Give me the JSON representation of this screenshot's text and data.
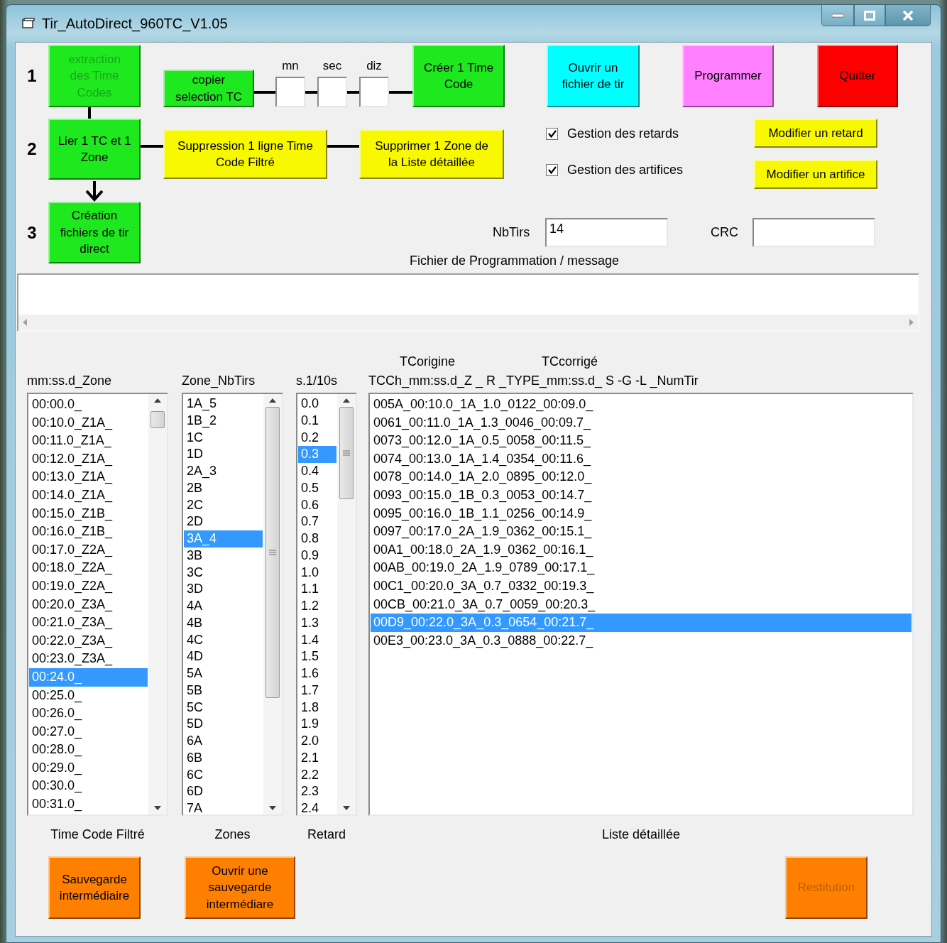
{
  "window": {
    "title": "Tir_AutoDirect_960TC_V1.05"
  },
  "step_1": {
    "number": "1",
    "extract_button": {
      "label": "extraction\ndes Time\nCodes",
      "color": "#1ee81e",
      "disabled": true
    },
    "copy_button": {
      "label": "copier\nselection TC",
      "color": "#1ee81e",
      "disabled": false
    },
    "time_fields": [
      {
        "label": "mn"
      },
      {
        "label": "sec"
      },
      {
        "label": "diz"
      }
    ],
    "create_button": {
      "label": "Créer 1 Time\nCode",
      "color": "#1ee81e",
      "disabled": false
    }
  },
  "actions": [
    {
      "label": "Ouvrir un\nfichier de tir",
      "color": "#00ffff",
      "disabled": false
    },
    {
      "label": "Programmer",
      "color": "#ff80ff",
      "disabled": false
    },
    {
      "label": "Quitter",
      "color": "#ff0000",
      "disabled": false
    }
  ],
  "step_2": {
    "number": "2",
    "link_button": {
      "label": "Lier 1 TC et 1\nZone",
      "color": "#1ee81e",
      "disabled": false
    },
    "delete_line_button": {
      "label": "Suppression 1 ligne Time\nCode Filtré",
      "color": "#f8f800",
      "disabled": false
    },
    "delete_zone_button": {
      "label": "Supprimer  1 Zone de\nla Liste détaillée",
      "color": "#f8f800",
      "disabled": false
    }
  },
  "options": [
    {
      "label": "Gestion des retards",
      "checked": true
    },
    {
      "label": "Gestion des artifices",
      "checked": true
    }
  ],
  "modify_buttons": [
    {
      "label": "Modifier un retard",
      "color": "#f8f800",
      "disabled": false
    },
    {
      "label": "Modifier un artifice",
      "color": "#f8f800",
      "disabled": false
    }
  ],
  "step_3": {
    "number": "3",
    "create_files_button": {
      "label": "Création\nfichiers de tir\ndirect",
      "color": "#1ee81e",
      "disabled": false
    }
  },
  "nb_tirs": {
    "label": "NbTirs",
    "value": "14"
  },
  "crc": {
    "label": "CRC"
  },
  "message": {
    "label": "Fichier de Programmation / message"
  },
  "lists": [
    {
      "header": "mm:ss.d_Zone",
      "footer": "Time Code Filtré",
      "items": [
        {
          "text": "00:00.0_",
          "selected": false
        },
        {
          "text": "00:10.0_Z1A_",
          "selected": false
        },
        {
          "text": "00:11.0_Z1A_",
          "selected": false
        },
        {
          "text": "00:12.0_Z1A_",
          "selected": false
        },
        {
          "text": "00:13.0_Z1A_",
          "selected": false
        },
        {
          "text": "00:14.0_Z1A_",
          "selected": false
        },
        {
          "text": "00:15.0_Z1B_",
          "selected": false
        },
        {
          "text": "00:16.0_Z1B_",
          "selected": false
        },
        {
          "text": "00:17.0_Z2A_",
          "selected": false
        },
        {
          "text": "00:18.0_Z2A_",
          "selected": false
        },
        {
          "text": "00:19.0_Z2A_",
          "selected": false
        },
        {
          "text": "00:20.0_Z3A_",
          "selected": false
        },
        {
          "text": "00:21.0_Z3A_",
          "selected": false
        },
        {
          "text": "00:22.0_Z3A_",
          "selected": false
        },
        {
          "text": "00:23.0_Z3A_",
          "selected": false
        },
        {
          "text": "00:24.0_",
          "selected": true
        },
        {
          "text": "00:25.0_",
          "selected": false
        },
        {
          "text": "00:26.0_",
          "selected": false
        },
        {
          "text": "00:27.0_",
          "selected": false
        },
        {
          "text": "00:28.0_",
          "selected": false
        },
        {
          "text": "00:29.0_",
          "selected": false
        },
        {
          "text": "00:30.0_",
          "selected": false
        },
        {
          "text": "00:31.0_",
          "selected": false
        }
      ]
    },
    {
      "header": "Zone_NbTirs",
      "footer": "Zones",
      "items": [
        {
          "text": "1A_5",
          "selected": false
        },
        {
          "text": "1B_2",
          "selected": false
        },
        {
          "text": "1C",
          "selected": false
        },
        {
          "text": "1D",
          "selected": false
        },
        {
          "text": "2A_3",
          "selected": false
        },
        {
          "text": "2B",
          "selected": false
        },
        {
          "text": "2C",
          "selected": false
        },
        {
          "text": "2D",
          "selected": false
        },
        {
          "text": "3A_4",
          "selected": true
        },
        {
          "text": "3B",
          "selected": false
        },
        {
          "text": "3C",
          "selected": false
        },
        {
          "text": "3D",
          "selected": false
        },
        {
          "text": "4A",
          "selected": false
        },
        {
          "text": "4B",
          "selected": false
        },
        {
          "text": "4C",
          "selected": false
        },
        {
          "text": "4D",
          "selected": false
        },
        {
          "text": "5A",
          "selected": false
        },
        {
          "text": "5B",
          "selected": false
        },
        {
          "text": "5C",
          "selected": false
        },
        {
          "text": "5D",
          "selected": false
        },
        {
          "text": "6A",
          "selected": false
        },
        {
          "text": "6B",
          "selected": false
        },
        {
          "text": "6C",
          "selected": false
        },
        {
          "text": "6D",
          "selected": false
        },
        {
          "text": "7A",
          "selected": false
        }
      ]
    },
    {
      "header": "s.1/10s",
      "footer": "Retard",
      "items": [
        {
          "text": "0.0",
          "selected": false
        },
        {
          "text": "0.1",
          "selected": false
        },
        {
          "text": "0.2",
          "selected": false
        },
        {
          "text": "0.3",
          "selected": true
        },
        {
          "text": "0.4",
          "selected": false
        },
        {
          "text": "0.5",
          "selected": false
        },
        {
          "text": "0.6",
          "selected": false
        },
        {
          "text": "0.7",
          "selected": false
        },
        {
          "text": "0.8",
          "selected": false
        },
        {
          "text": "0.9",
          "selected": false
        },
        {
          "text": "1.0",
          "selected": false
        },
        {
          "text": "1.1",
          "selected": false
        },
        {
          "text": "1.2",
          "selected": false
        },
        {
          "text": "1.3",
          "selected": false
        },
        {
          "text": "1.4",
          "selected": false
        },
        {
          "text": "1.5",
          "selected": false
        },
        {
          "text": "1.6",
          "selected": false
        },
        {
          "text": "1.7",
          "selected": false
        },
        {
          "text": "1.8",
          "selected": false
        },
        {
          "text": "1.9",
          "selected": false
        },
        {
          "text": "2.0",
          "selected": false
        },
        {
          "text": "2.1",
          "selected": false
        },
        {
          "text": "2.2",
          "selected": false
        },
        {
          "text": "2.3",
          "selected": false
        },
        {
          "text": "2.4",
          "selected": false
        }
      ]
    },
    {
      "super_headers": [
        "TCorigine",
        "TCcorrigé"
      ],
      "header": "TCCh_mm:ss.d_Z _ R _TYPE_mm:ss.d_ S -G -L _NumTir",
      "footer": "Liste détaillée",
      "items": [
        {
          "text": "005A_00:10.0_1A_1.0_0122_00:09.0_",
          "selected": false
        },
        {
          "text": "0061_00:11.0_1A_1.3_0046_00:09.7_",
          "selected": false
        },
        {
          "text": "0073_00:12.0_1A_0.5_0058_00:11.5_",
          "selected": false
        },
        {
          "text": "0074_00:13.0_1A_1.4_0354_00:11.6_",
          "selected": false
        },
        {
          "text": "0078_00:14.0_1A_2.0_0895_00:12.0_",
          "selected": false
        },
        {
          "text": "0093_00:15.0_1B_0.3_0053_00:14.7_",
          "selected": false
        },
        {
          "text": "0095_00:16.0_1B_1.1_0256_00:14.9_",
          "selected": false
        },
        {
          "text": "0097_00:17.0_2A_1.9_0362_00:15.1_",
          "selected": false
        },
        {
          "text": "00A1_00:18.0_2A_1.9_0362_00:16.1_",
          "selected": false
        },
        {
          "text": "00AB_00:19.0_2A_1.9_0789_00:17.1_",
          "selected": false
        },
        {
          "text": "00C1_00:20.0_3A_0.7_0332_00:19.3_",
          "selected": false
        },
        {
          "text": "00CB_00:21.0_3A_0.7_0059_00:20.3_",
          "selected": false
        },
        {
          "text": "00D9_00:22.0_3A_0.3_0654_00:21.7_",
          "selected": true
        },
        {
          "text": "00E3_00:23.0_3A_0.3_0888_00:22.7_",
          "selected": false
        }
      ]
    }
  ],
  "bottom_buttons": [
    {
      "label": "Sauvegarde\nintermédiaire",
      "color": "#ff8000",
      "disabled": false
    },
    {
      "label": "Ouvrir une\nsauvegarde\nintermédiare",
      "color": "#ff8000",
      "disabled": false
    },
    {
      "label": "Restitution",
      "color": "#ff8000",
      "disabled": true
    }
  ]
}
